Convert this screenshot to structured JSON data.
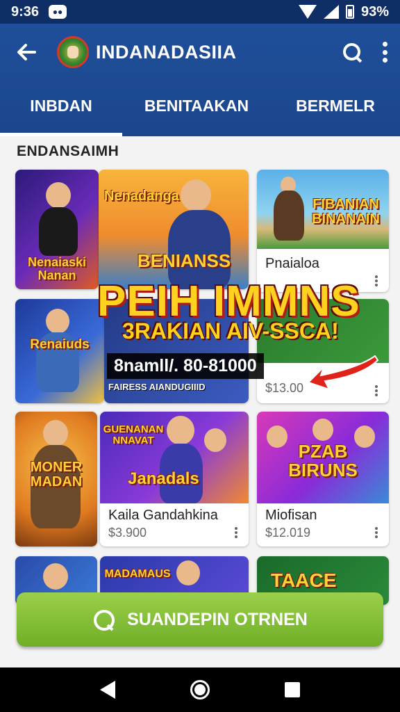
{
  "status_bar": {
    "time": "9:36",
    "battery": "93%"
  },
  "app_bar": {
    "title": "INDANADASIIA"
  },
  "tabs": [
    {
      "label": "INBDAN",
      "active": true
    },
    {
      "label": "BENITAAKAN",
      "active": false
    },
    {
      "label": "BERMELR",
      "active": false
    }
  ],
  "section": {
    "title": "ENDANSAIMH"
  },
  "cards": [
    {
      "art_text": "Nenaiaski Nanan"
    },
    {
      "art_text_top": "Nenadanga",
      "art_text": "BENIANSS"
    },
    {
      "art_text": "FIBANIAN BINANAIN",
      "title": "Pnaialoa"
    },
    {
      "art_text": "Renaiuds"
    },
    {
      "art_text": "",
      "price": "$13.00"
    },
    {
      "art_text": "MONER MADAN"
    },
    {
      "art_text_top": "GUENANAN NNAVAT",
      "art_text": "Janadals",
      "title": "Kaila Gandahkina",
      "price": "$3.900"
    },
    {
      "art_text": "PZAB BIRUNS",
      "title": "Miofisan",
      "price": "$12.019"
    },
    {
      "art_text": ""
    },
    {
      "art_text": "MADAMAUS"
    },
    {
      "art_text": "TAACE"
    }
  ],
  "promo": {
    "headline": "PEIH IMMNS",
    "subline": "3RAKIAN AIV-SSCA!",
    "price_line": "8namll/. 80-81000",
    "small_caption": "FAIRESS AIANDUGIIID"
  },
  "cta": {
    "label": "SUANDEPIN OTRNEN"
  },
  "colors": {
    "app_bar": "#1f4f9a",
    "cta": "#7dbb32",
    "status_bar": "#0f2e66"
  }
}
